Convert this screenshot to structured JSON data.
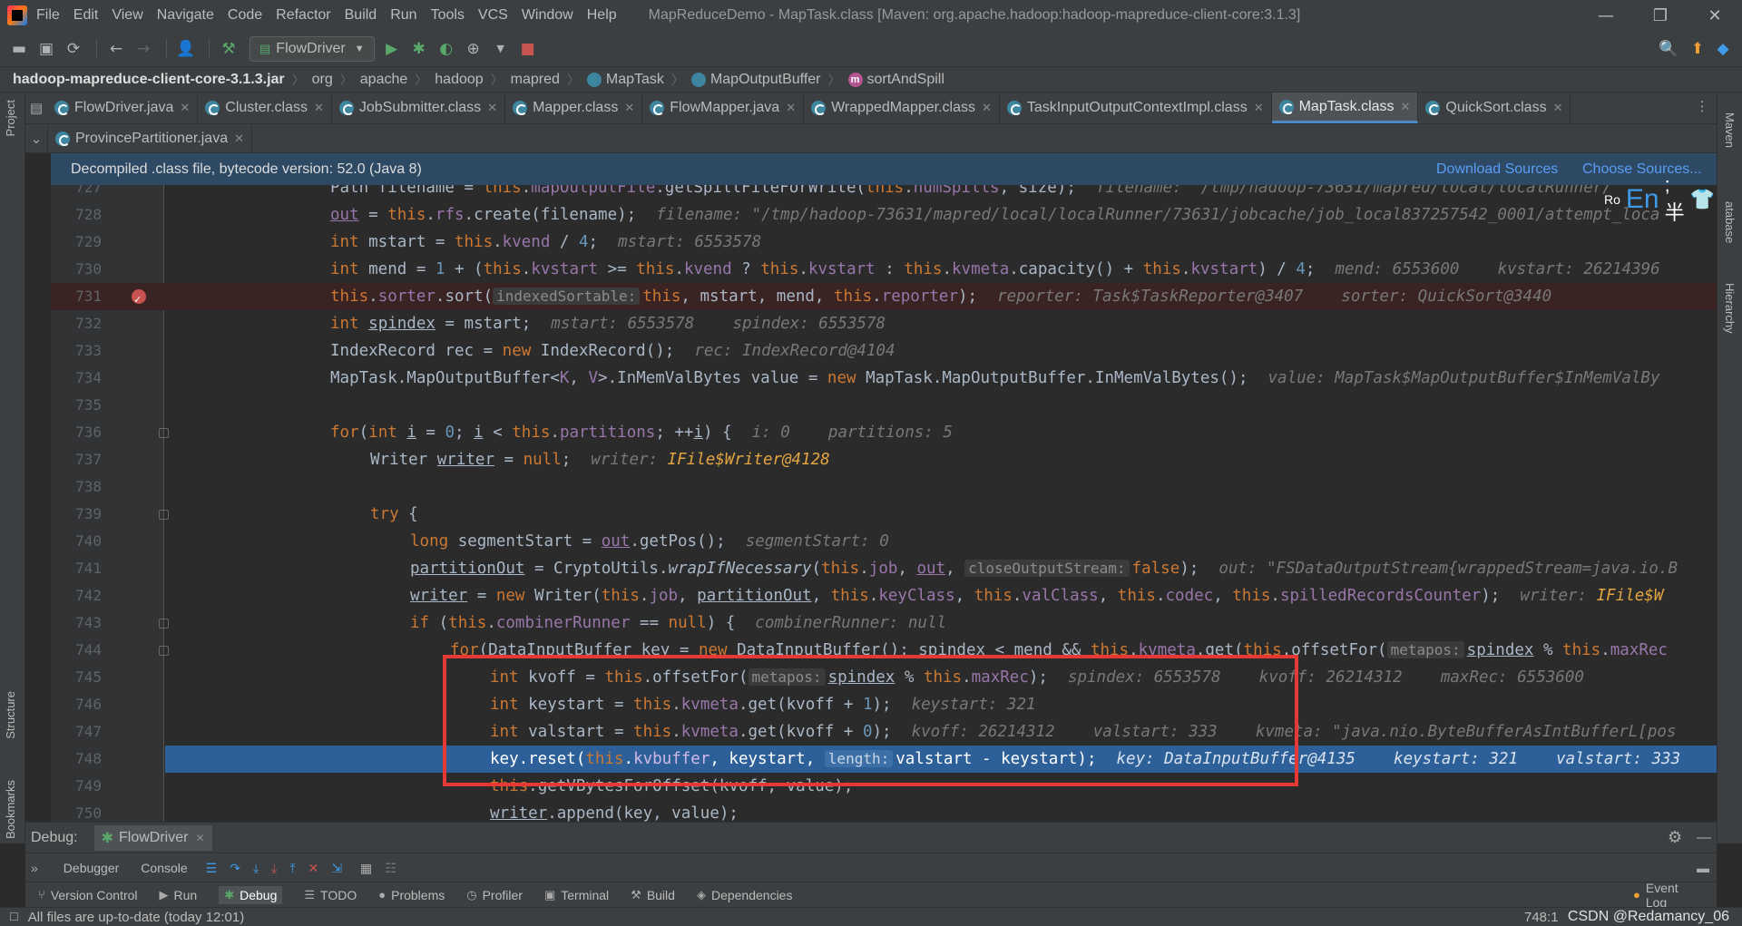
{
  "menubar": {
    "items": [
      "File",
      "Edit",
      "View",
      "Navigate",
      "Code",
      "Refactor",
      "Build",
      "Run",
      "Tools",
      "VCS",
      "Window",
      "Help"
    ],
    "title": "MapReduceDemo - MapTask.class [Maven: org.apache.hadoop:hadoop-mapreduce-client-core:3.1.3]"
  },
  "toolbar": {
    "run_config": "FlowDriver"
  },
  "breadcrumb": {
    "jar": "hadoop-mapreduce-client-core-3.1.3.jar",
    "parts": [
      "org",
      "apache",
      "hadoop",
      "mapred"
    ],
    "class1": "MapTask",
    "class2": "MapOutputBuffer",
    "method": "sortAndSpill"
  },
  "tabs": {
    "row1": [
      "FlowDriver.java",
      "Cluster.class",
      "JobSubmitter.class",
      "Mapper.class",
      "FlowMapper.java",
      "WrappedMapper.class",
      "TaskInputOutputContextImpl.class",
      "MapTask.class",
      "QuickSort.class"
    ],
    "active": "MapTask.class",
    "row2": [
      "ProvincePartitioner.java"
    ]
  },
  "banner": {
    "text": "Decompiled .class file, bytecode version: 52.0 (Java 8)",
    "download": "Download Sources",
    "choose": "Choose Sources..."
  },
  "side": {
    "project": "Project",
    "structure": "Structure",
    "bookmarks": "Bookmarks",
    "maven": "Maven",
    "database": "atabase",
    "hierarchy": "Hierarchy"
  },
  "editor": {
    "lines": [
      {
        "n": "727",
        "top": "Path filename = this.mapOutputFile.getSpillFileForWrite(this.numSpills, size);   filename: \"/tmp/hadoop-73631/mapred/local/localRunner/"
      },
      {
        "n": "728"
      },
      {
        "n": "729"
      },
      {
        "n": "730"
      },
      {
        "n": "731"
      },
      {
        "n": "732"
      },
      {
        "n": "733"
      },
      {
        "n": "734"
      },
      {
        "n": "735"
      },
      {
        "n": "736"
      },
      {
        "n": "737"
      },
      {
        "n": "738"
      },
      {
        "n": "739"
      },
      {
        "n": "740"
      },
      {
        "n": "741"
      },
      {
        "n": "742"
      },
      {
        "n": "743"
      },
      {
        "n": "744"
      },
      {
        "n": "745"
      },
      {
        "n": "746"
      },
      {
        "n": "747"
      },
      {
        "n": "748"
      },
      {
        "n": "749"
      },
      {
        "n": "750"
      }
    ],
    "overlay": "Ro  En ; 半"
  },
  "debug": {
    "label": "Debug:",
    "session": "FlowDriver",
    "tabs": [
      "Debugger",
      "Console"
    ]
  },
  "bottom_tools": [
    "Version Control",
    "Run",
    "Debug",
    "TODO",
    "Problems",
    "Profiler",
    "Terminal",
    "Build",
    "Dependencies"
  ],
  "event_log": "Event Log",
  "status": {
    "message": "All files are up-to-date (today 12:01)",
    "position": "748:1",
    "watermark": "CSDN @Redamancy_06"
  }
}
